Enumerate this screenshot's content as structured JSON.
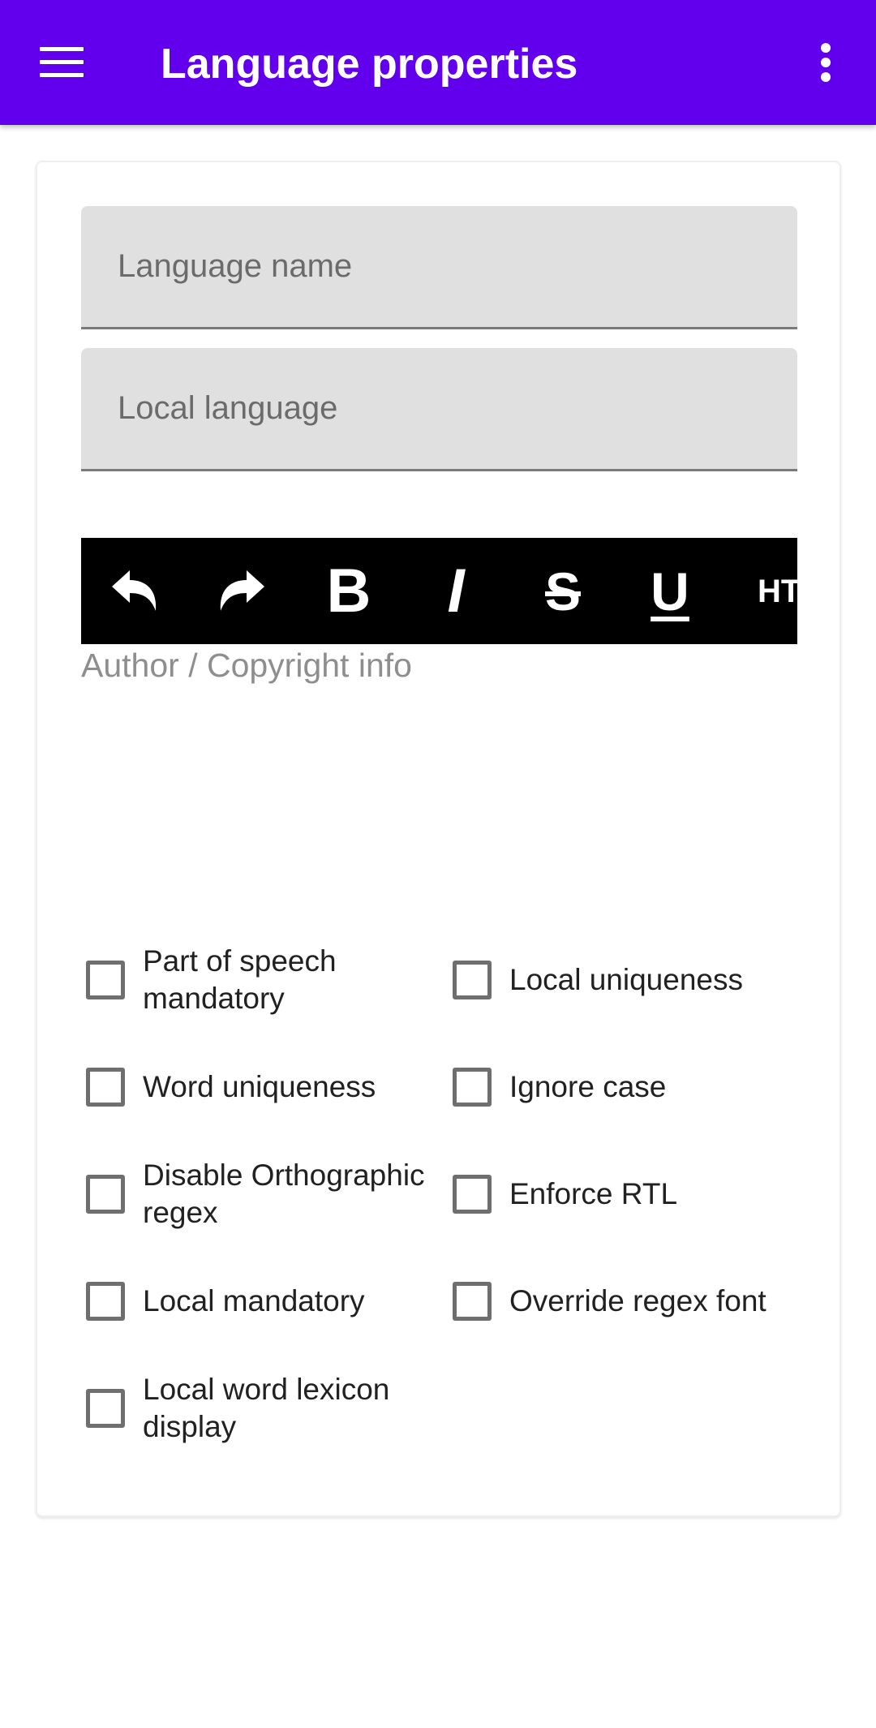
{
  "appbar": {
    "title": "Language properties",
    "background": "#6200ee",
    "menu_icon": "hamburger-menu-icon",
    "overflow_icon": "more-vert-icon"
  },
  "form": {
    "language_name": {
      "placeholder": "Language name",
      "value": ""
    },
    "local_language": {
      "placeholder": "Local language",
      "value": ""
    },
    "toolbar": {
      "buttons": [
        {
          "name": "undo",
          "icon": "undo-icon"
        },
        {
          "name": "redo",
          "icon": "redo-icon"
        },
        {
          "name": "bold",
          "label": "B"
        },
        {
          "name": "italic",
          "label": "I"
        },
        {
          "name": "strikethrough",
          "label": "S"
        },
        {
          "name": "underline",
          "label": "U"
        },
        {
          "name": "html",
          "label": "HT"
        }
      ]
    },
    "editor": {
      "placeholder": "Author / Copyright info"
    },
    "checkboxes": [
      {
        "label": "Part of speech mandatory",
        "checked": false
      },
      {
        "label": "Local uniqueness",
        "checked": false
      },
      {
        "label": "Word uniqueness",
        "checked": false
      },
      {
        "label": "Ignore case",
        "checked": false
      },
      {
        "label": "Disable Orthographic regex",
        "checked": false
      },
      {
        "label": "Enforce RTL",
        "checked": false
      },
      {
        "label": "Local mandatory",
        "checked": false
      },
      {
        "label": "Override regex font",
        "checked": false
      },
      {
        "label": "Local word lexicon display",
        "checked": false
      }
    ]
  }
}
